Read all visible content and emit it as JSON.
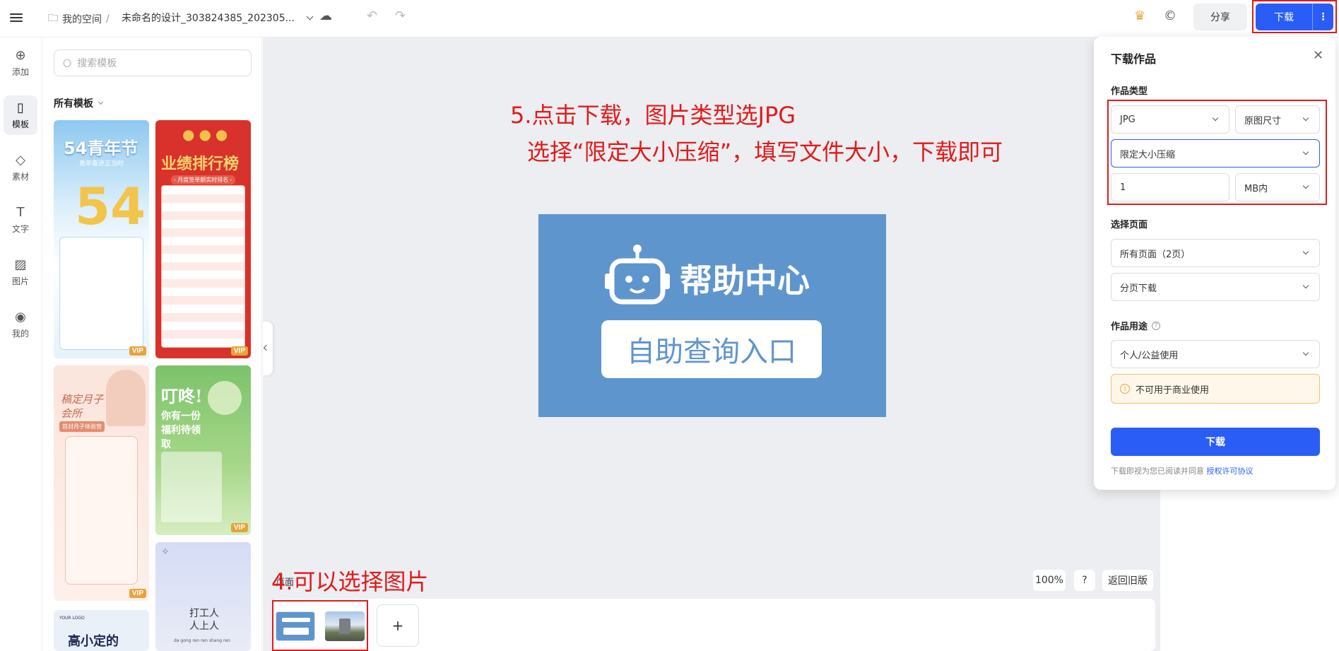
{
  "header": {
    "workspace": "我的空间",
    "separator": "/",
    "doc_title": "未命名的设计_303824385_202305...",
    "share": "分享",
    "download": "下载",
    "more": "⋮"
  },
  "nav": [
    {
      "label": "添加",
      "icon": "add-icon"
    },
    {
      "label": "模板",
      "icon": "template-icon"
    },
    {
      "label": "素材",
      "icon": "material-icon"
    },
    {
      "label": "文字",
      "icon": "text-icon"
    },
    {
      "label": "图片",
      "icon": "image-icon"
    },
    {
      "label": "我的",
      "icon": "user-icon"
    }
  ],
  "panel": {
    "search_placeholder": "搜索模板",
    "all_templates": "所有模板",
    "templates": [
      {
        "title": "54青年节",
        "sub": "青年奋进正当时",
        "vip": "VIP"
      },
      {
        "title": "业绩排行榜",
        "sub": "- 月度签单额实时排名 -",
        "vip": "VIP"
      },
      {
        "title": "稿定月子会所",
        "sub": "首封月子体验营",
        "vip": "VIP"
      },
      {
        "title": "叮咚!",
        "sub": "你有一份福利待领取",
        "vip": "VIP"
      },
      {
        "title": "高小定的",
        "sub": "YOUR LOGO",
        "vip": ""
      },
      {
        "title": "打工人 人上人",
        "sub": "da gong ren ren shang ren",
        "vip": ""
      }
    ]
  },
  "annotations": {
    "step5_line1": "5.点击下载，图片类型选JPG",
    "step5_line2": "选择“限定大小压缩”，填写文件大小，下载即可",
    "step4": "4.可以选择图片"
  },
  "design": {
    "title": "帮助中心",
    "entry": "自助查询入口"
  },
  "canvas_controls": {
    "zoom": "100%",
    "help": "?",
    "back_old": "返回旧版",
    "page_label": "页面",
    "add_page": "+"
  },
  "download_panel": {
    "title": "下载作品",
    "close": "✕",
    "type_label": "作品类型",
    "format": "JPG",
    "size_mode": "原图尺寸",
    "compress": "限定大小压缩",
    "size_value": "1",
    "size_unit": "MB内",
    "pages_label": "选择页面",
    "pages": "所有页面（2页）",
    "split": "分页下载",
    "usage_label": "作品用途",
    "usage": "个人/公益使用",
    "warning": "不可用于商业使用",
    "download_btn": "下载",
    "note": "下载即视为您已阅读并同意",
    "license": "授权许可协议"
  },
  "colors": {
    "accent": "#2a5cf6",
    "annotation_red": "#e01b1b",
    "design_bg": "#5f95cd"
  }
}
